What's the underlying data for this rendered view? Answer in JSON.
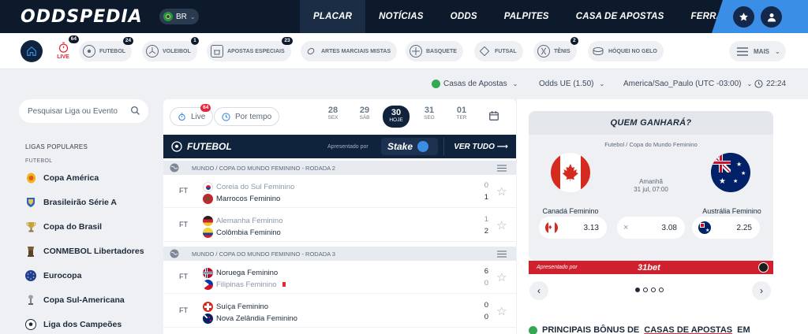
{
  "brand": {
    "logo": "ODDSPEDIA"
  },
  "country": {
    "code": "BR"
  },
  "nav": {
    "items": [
      "PLACAR",
      "NOTÍCIAS",
      "ODDS",
      "PALPITES",
      "CASA DE APOSTAS",
      "FERRAMENTAS"
    ],
    "active": "PLACAR"
  },
  "sports": {
    "live": {
      "label": "LIVE",
      "count": "64"
    },
    "chips": [
      {
        "label": "FUTEBOL",
        "count": "24",
        "icon": "soccer-ball-icon"
      },
      {
        "label": "VOLEIBOL",
        "count": "1",
        "icon": "volleyball-icon"
      },
      {
        "label": "APOSTAS ESPECIAIS",
        "count": "23",
        "icon": "special-bets-icon"
      },
      {
        "label": "ARTES MARCIAIS MISTAS",
        "count": "",
        "icon": "mma-glove-icon"
      },
      {
        "label": "BASQUETE",
        "count": "",
        "icon": "basketball-icon"
      },
      {
        "label": "FUTSAL",
        "count": "",
        "icon": "futsal-icon"
      },
      {
        "label": "TÊNIS",
        "count": "2",
        "icon": "tennis-ball-icon"
      },
      {
        "label": "HÓQUEI NO GELO",
        "count": "",
        "icon": "ice-hockey-icon"
      }
    ],
    "more": "MAIS"
  },
  "settings": {
    "bookmakers": "Casas de Apostas",
    "odds_format": "Odds UE (1.50)",
    "timezone": "America/Sao_Paulo (UTC -03:00)",
    "time": "22:24"
  },
  "sidebar": {
    "search_placeholder": "Pesquisar Liga ou Evento",
    "popular_heading": "LIGAS POPULARES",
    "sport_heading": "FUTEBOL",
    "leagues": [
      "Copa América",
      "Brasileirão Série A",
      "Copa do Brasil",
      "CONMEBOL Libertadores",
      "Eurocopa",
      "Copa Sul-Americana",
      "Liga dos Campeões"
    ]
  },
  "center": {
    "live_label": "Live",
    "live_count": "64",
    "by_time_label": "Por tempo",
    "days": [
      {
        "num": "28",
        "wd": "SEX"
      },
      {
        "num": "29",
        "wd": "SÁB"
      },
      {
        "num": "30",
        "wd": "HOJE",
        "today": true
      },
      {
        "num": "31",
        "wd": "SEG"
      },
      {
        "num": "01",
        "wd": "TER"
      }
    ],
    "sport_title": "FUTEBOL",
    "presented_by": "Apresentado por",
    "sponsor": "Stake",
    "see_all": "VER TUDO",
    "groups": [
      {
        "league": "MUNDO  /  COPA DO MUNDO FEMININO - RODADA 2",
        "matches": [
          {
            "status": "FT",
            "home": "Coreia do Sul Feminino",
            "away": "Marrocos Feminino",
            "home_score": "0",
            "away_score": "1",
            "winner": "away"
          },
          {
            "status": "FT",
            "home": "Alemanha Feminino",
            "away": "Colômbia Feminino",
            "home_score": "1",
            "away_score": "2",
            "winner": "away"
          }
        ]
      },
      {
        "league": "MUNDO  /  COPA DO MUNDO FEMININO - RODADA 3",
        "matches": [
          {
            "status": "FT",
            "home": "Noruega Feminino",
            "away": "Filipinas Feminino",
            "home_score": "6",
            "away_score": "0",
            "winner": "home"
          },
          {
            "status": "FT",
            "home": "Suíça Feminino",
            "away": "Nova Zelândia Feminino",
            "home_score": "0",
            "away_score": "0",
            "winner": "draw"
          }
        ]
      }
    ]
  },
  "who_wins": {
    "title": "QUEM GANHARÁ?",
    "competition": "Futebol / Copa do Mundo Feminino",
    "when_label": "Amanhã",
    "when_date": "31 jul, 07:00",
    "home": "Canadá Feminino",
    "away": "Austrália Feminino",
    "odds": {
      "home": "3.13",
      "draw_symbol": "×",
      "draw": "3.08",
      "away": "2.25"
    },
    "presented_by": "Apresentado por",
    "sponsor": "31bet",
    "carousel": {
      "pages": 4,
      "active": 1
    }
  },
  "bonus": {
    "title_start": "PRINCIPAIS BÔNUS DE",
    "title_link": "CASAS DE APOSTAS",
    "title_end": "EM"
  }
}
